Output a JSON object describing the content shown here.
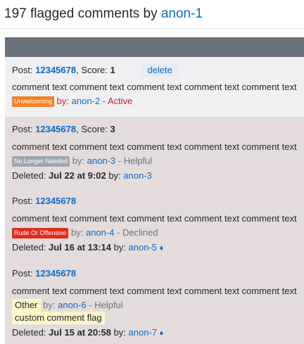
{
  "header": {
    "count_text": "197 flagged comments by",
    "user": "anon-1"
  },
  "entries": [
    {
      "post_label": "Post:",
      "post_id": "12345678",
      "score_label": ", Score:",
      "score": "1",
      "delete_label": "delete",
      "comment": "comment text comment text comment text comment text comment text",
      "flag": "Unwelcoming",
      "by_label": "by:",
      "flagger": "anon-2",
      "status": "- Active"
    },
    {
      "post_label": "Post:",
      "post_id": "12345678",
      "score_label": ", Score:",
      "score": "3",
      "comment": "comment text comment text comment text comment text comment text",
      "flag": "No Longer Needed",
      "by_label": "by:",
      "flagger": "anon-3",
      "status": "- Helpful",
      "deleted_label": "Deleted:",
      "deleted_date": "Jul 22 at 9:02",
      "deleted_by_label": "by:",
      "deleted_by": "anon-3"
    },
    {
      "post_label": "Post:",
      "post_id": "12345678",
      "comment": "comment text comment text comment text comment text comment text",
      "flag": "Rude Or Offensive",
      "by_label": "by:",
      "flagger": "anon-4",
      "status": "- Declined",
      "deleted_label": "Deleted:",
      "deleted_date": "Jul 16 at 13:14",
      "deleted_by_label": "by:",
      "deleted_by": "anon-5",
      "moderator_mark": "♦"
    },
    {
      "post_label": "Post:",
      "post_id": "12345678",
      "comment": "comment text comment text comment text comment text comment text",
      "flag": "Other",
      "by_label": "by:",
      "flagger": "anon-6",
      "status": "- Helpful",
      "custom_flag_text": "custom comment flag",
      "deleted_label": "Deleted:",
      "deleted_date": "Jul 15 at 20:58",
      "deleted_by_label": "by:",
      "deleted_by": "anon-7",
      "moderator_mark": "♦"
    }
  ],
  "colors": {
    "link": "#0c6ac7",
    "active_status": "#c91d2e",
    "unwelcoming_tag": "#f48024",
    "rude_tag": "#e12b1c",
    "nln_tag": "#9fa6ad",
    "deleted_bg": "#e4dcdc",
    "active_bg": "#eff0f1",
    "other_highlight": "#fdf7c8"
  }
}
